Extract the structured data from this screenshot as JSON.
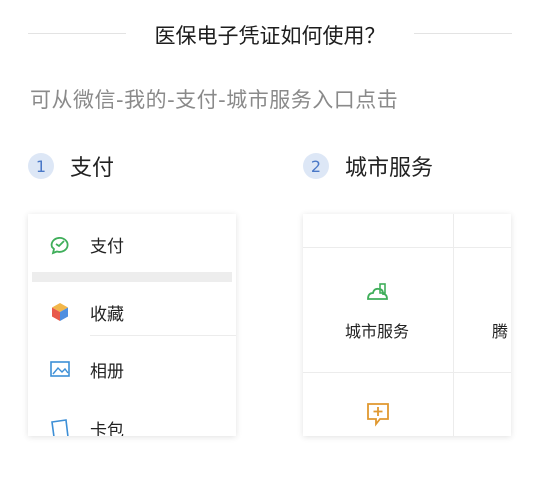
{
  "header": {
    "title": "医保电子凭证如何使用？"
  },
  "subtitle": "可从微信-我的-支付-城市服务入口点击",
  "steps": [
    {
      "number": "1",
      "label": "支付"
    },
    {
      "number": "2",
      "label": "城市服务"
    }
  ],
  "menu": {
    "items": [
      {
        "label": "支付",
        "icon": "payment-icon"
      },
      {
        "label": "收藏",
        "icon": "favorites-cube-icon"
      },
      {
        "label": "相册",
        "icon": "album-image-icon"
      },
      {
        "label": "卡包",
        "icon": "card-wallet-icon"
      }
    ]
  },
  "city_services": {
    "items": [
      {
        "label": "城市服务",
        "icon": "city-service-icon"
      },
      {
        "label": "腾",
        "icon": ""
      },
      {
        "label": "",
        "icon": "medical-message-icon"
      }
    ]
  },
  "colors": {
    "accent_green": "#3fae5a",
    "step_bg": "#dde7f6",
    "step_text": "#4a78c7",
    "orange": "#e0982f"
  }
}
